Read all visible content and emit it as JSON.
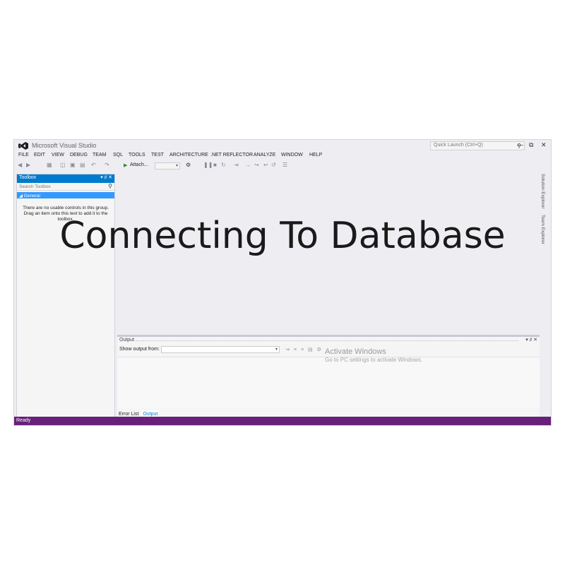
{
  "window": {
    "title": "Microsoft Visual Studio",
    "quick_launch_placeholder": "Quick Launch (Ctrl+Q)",
    "controls": [
      "—",
      "⧉",
      "✕"
    ]
  },
  "menu": [
    "FILE",
    "EDIT",
    "VIEW",
    "DEBUG",
    "TEAM",
    "SQL",
    "TOOLS",
    "TEST",
    "ARCHITECTURE",
    ".NET REFLECTOR",
    "ANALYZE",
    "WINDOW",
    "HELP"
  ],
  "toolbar": {
    "attach_label": "Attach...",
    "attach_dropdown": "▾"
  },
  "toolbox": {
    "title": "Toolbox",
    "search_placeholder": "Search Toolbox",
    "group": "◢ General",
    "empty_message": "There are no usable controls in this group. Drag an item onto this text to add it to the toolbox."
  },
  "side_tabs": [
    "Solution Explorer",
    "Team Explorer"
  ],
  "output": {
    "title": "Output",
    "show_output_label": "Show output from:",
    "tabs": [
      "Error List",
      "Output"
    ],
    "active_tab": "Output"
  },
  "watermark": {
    "line1": "Activate Windows",
    "line2": "Go to PC settings to activate Windows."
  },
  "status": "Ready",
  "overlay_title": "Connecting To Database",
  "colors": {
    "accent": "#007acc",
    "statusbar": "#68217a",
    "selection": "#3399ff"
  }
}
